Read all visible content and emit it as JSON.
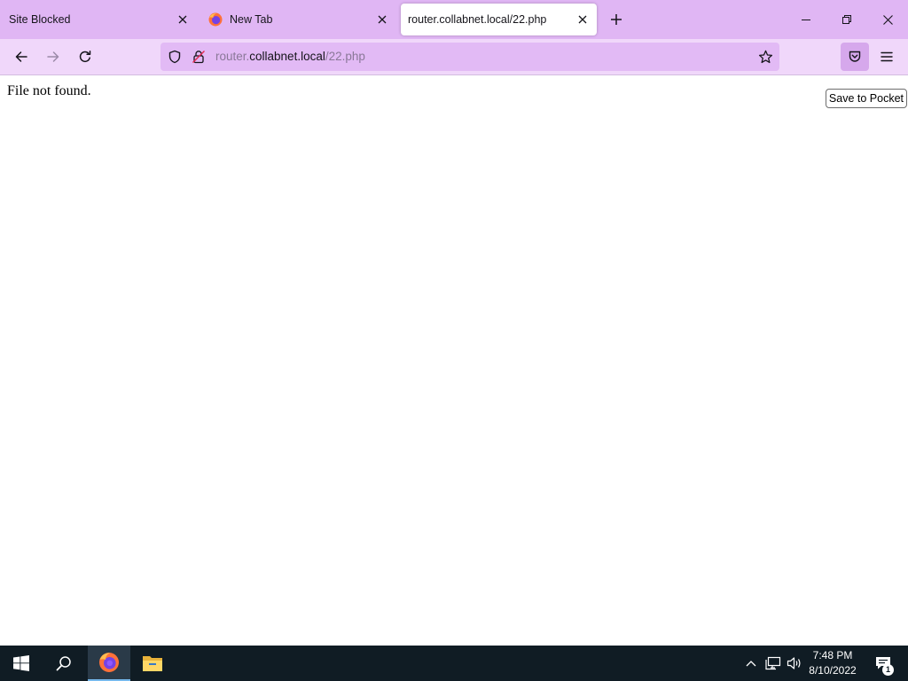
{
  "browser": {
    "tabs": [
      {
        "title": "Site Blocked",
        "has_favicon": false,
        "active": false
      },
      {
        "title": "New Tab",
        "favicon": "firefox-icon",
        "active": false
      },
      {
        "title": "router.collabnet.local/22.php",
        "has_favicon": false,
        "active": true
      }
    ],
    "url": {
      "prefix": "router.",
      "host": "collabnet.local",
      "path": "/22.php"
    },
    "colors": {
      "tabstrip": "#e0b6f4",
      "navbar": "#f0d7fa",
      "urlbar": "#e2baf5"
    }
  },
  "page": {
    "message": "File not found.",
    "tooltip": "Save to Pocket"
  },
  "taskbar": {
    "time": "7:48 PM",
    "date": "8/10/2022",
    "notification_count": "1",
    "apps": [
      "windows-start-icon",
      "search-icon",
      "firefox-icon",
      "file-explorer-icon"
    ]
  }
}
